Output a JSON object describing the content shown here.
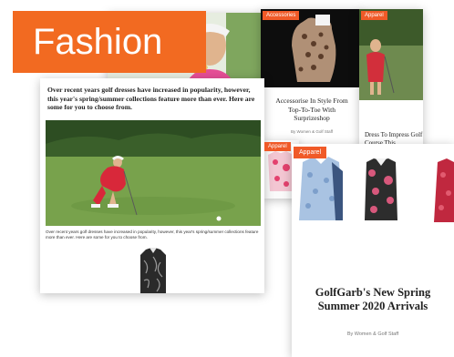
{
  "label": {
    "text": "Fashion"
  },
  "back_cards": {
    "accessories": {
      "tag": "Accessories",
      "title": "Accessorise In Style From Top-To-Toe With Surprizeshop",
      "byline": "By Women & Golf Staff"
    },
    "apparel_right": {
      "tag": "Apparel",
      "title": "Dress To Impress Golf Course This"
    },
    "apparel_small": {
      "tag": "Apparel"
    }
  },
  "article": {
    "heading": "Over recent years golf dresses have increased in popularity, however, this year's spring/summer collections feature more than ever. Here are some for you to choose from.",
    "caption": "Over recent years golf dresses have increased in popularity, however, this year's spring/summer collections feature more than ever. Here are some for you to choose from."
  },
  "front_card": {
    "tag": "Apparel",
    "title": "GolfGarb's New Spring Summer 2020 Arrivals",
    "byline": "By Women & Golf Staff"
  },
  "colors": {
    "accent": "#f26a21",
    "tag": "#f05a28"
  }
}
